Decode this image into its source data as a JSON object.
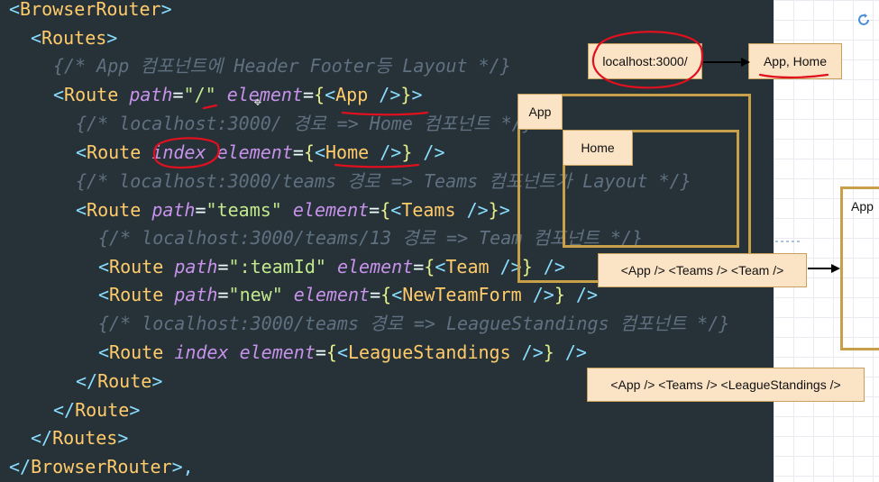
{
  "code": {
    "l0": {
      "open": "<",
      "name": "BrowserRouter",
      "close": ">"
    },
    "l1": {
      "open": "<",
      "name": "Routes",
      "close": ">"
    },
    "l2": {
      "comment": "{/* App 컴포넌트에 Header Footer등 Layout */}"
    },
    "l3": {
      "open": "<",
      "name": "Route",
      "attr1": "path",
      "eq1": "=",
      "val1": "\"/\"",
      "attr2": "element",
      "eq2": "=",
      "brace_open": "{",
      "inner_open": "<",
      "inner_name": "App",
      "inner_close": " />",
      "brace_close": "}",
      "close": ">"
    },
    "l4": {
      "comment": "{/* localhost:3000/ 경로 => Home 컴포넌트 */}"
    },
    "l5": {
      "open": "<",
      "name": "Route",
      "attr1": "index",
      "attr2": "element",
      "eq2": "=",
      "brace_open": "{",
      "inner_open": "<",
      "inner_name": "Home",
      "inner_close": " />",
      "brace_close": "}",
      "close": " />"
    },
    "l6": {
      "comment": "{/* localhost:3000/teams 경로 => Teams 컴포넌트가 Layout */}"
    },
    "l7": {
      "open": "<",
      "name": "Route",
      "attr1": "path",
      "eq1": "=",
      "val1": "\"teams\"",
      "attr2": "element",
      "eq2": "=",
      "brace_open": "{",
      "inner_open": "<",
      "inner_name": "Teams",
      "inner_close": " />",
      "brace_close": "}",
      "close": ">"
    },
    "l8": {
      "comment": "{/* localhost:3000/teams/13 경로 => Team 컴포넌트 */}"
    },
    "l9": {
      "open": "<",
      "name": "Route",
      "attr1": "path",
      "eq1": "=",
      "val1": "\":teamId\"",
      "attr2": "element",
      "eq2": "=",
      "brace_open": "{",
      "inner_open": "<",
      "inner_name": "Team",
      "inner_close": " />",
      "brace_close": "}",
      "close": " />"
    },
    "l10": {
      "open": "<",
      "name": "Route",
      "attr1": "path",
      "eq1": "=",
      "val1": "\"new\"",
      "attr2": "element",
      "eq2": "=",
      "brace_open": "{",
      "inner_open": "<",
      "inner_name": "NewTeamForm",
      "inner_close": " />",
      "brace_close": "}",
      "close": " />"
    },
    "l11": {
      "comment": "{/* localhost:3000/teams 경로 => LeagueStandings 컴포넌트 */}"
    },
    "l12": {
      "open": "<",
      "name": "Route",
      "attr1": "index",
      "attr2": "element",
      "eq2": "=",
      "brace_open": "{",
      "inner_open": "<",
      "inner_name": "LeagueStandings",
      "inner_close": " />",
      "brace_close": "}",
      "close": " />"
    },
    "l13": {
      "open": "</",
      "name": "Route",
      "close": ">"
    },
    "l14": {
      "open": "</",
      "name": "Route",
      "close": ">"
    },
    "l15": {
      "open": "</",
      "name": "Routes",
      "close": ">"
    },
    "l16": {
      "open": "</",
      "name": "BrowserRouter",
      "close": ">,"
    }
  },
  "diagram": {
    "url_box": "localhost:3000/",
    "result_box": "App, Home",
    "frame_app_label": "App",
    "frame_home_label": "Home",
    "route_team": "<App /> <Teams /> <Team />",
    "route_standings": "<App /> <Teams /> <LeagueStandings />",
    "right_frame_label": "App"
  },
  "colors": {
    "tag": "#89ddff",
    "component": "#ffcb6b",
    "attribute": "#c792ea",
    "string": "#c3e88d",
    "comment": "#607080",
    "annotation": "#e0101e",
    "frame": "#c8a04a",
    "box_fill": "#fbe3c6"
  }
}
